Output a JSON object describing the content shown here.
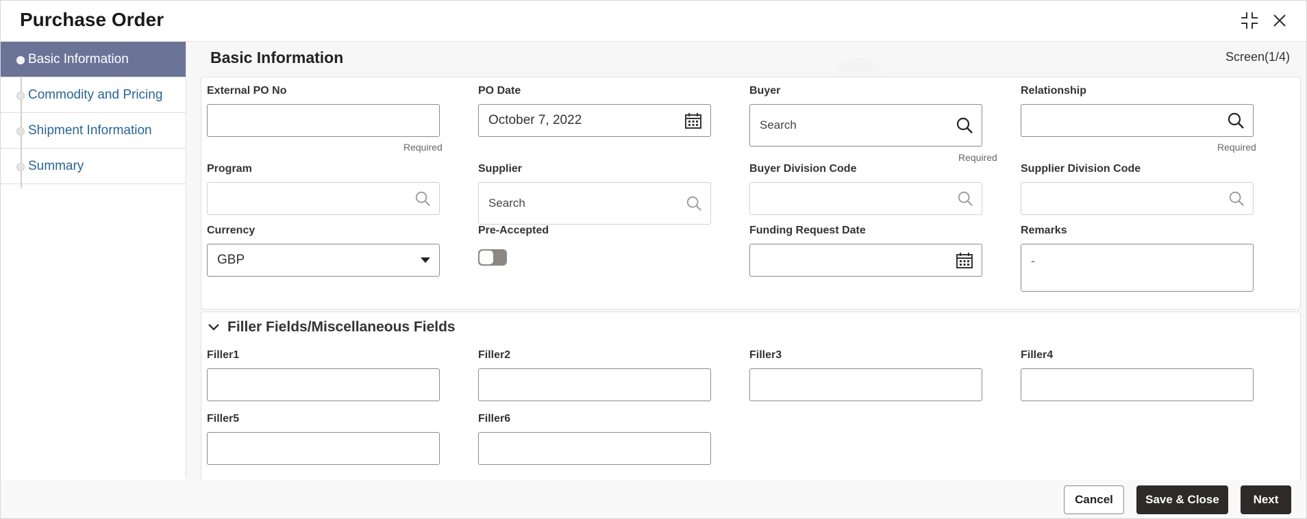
{
  "window": {
    "title": "Purchase Order"
  },
  "sidebar": {
    "items": [
      {
        "label": "Basic Information",
        "active": true
      },
      {
        "label": "Commodity and Pricing",
        "active": false
      },
      {
        "label": "Shipment Information",
        "active": false
      },
      {
        "label": "Summary",
        "active": false
      }
    ]
  },
  "main": {
    "heading": "Basic Information",
    "screen_indicator": "Screen(1/4)",
    "fields": {
      "external_po_no": {
        "label": "External PO No",
        "value": "",
        "hint": "Required"
      },
      "po_date": {
        "label": "PO Date",
        "value": "October 7, 2022"
      },
      "buyer": {
        "label": "Buyer",
        "placeholder": "Search",
        "hint": "Required"
      },
      "relationship": {
        "label": "Relationship",
        "value": "",
        "hint": "Required"
      },
      "program": {
        "label": "Program",
        "value": ""
      },
      "supplier": {
        "label": "Supplier",
        "placeholder": "Search"
      },
      "buyer_division_code": {
        "label": "Buyer Division Code",
        "value": ""
      },
      "supplier_division_code": {
        "label": "Supplier Division Code",
        "value": ""
      },
      "currency": {
        "label": "Currency",
        "value": "GBP"
      },
      "pre_accepted": {
        "label": "Pre-Accepted",
        "on": false
      },
      "funding_request_date": {
        "label": "Funding Request Date",
        "value": ""
      },
      "remarks": {
        "label": "Remarks",
        "value": "-"
      }
    },
    "filler_section": {
      "title": "Filler Fields/Miscellaneous Fields",
      "expanded": true,
      "fields": [
        {
          "label": "Filler1",
          "value": ""
        },
        {
          "label": "Filler2",
          "value": ""
        },
        {
          "label": "Filler3",
          "value": ""
        },
        {
          "label": "Filler4",
          "value": ""
        },
        {
          "label": "Filler5",
          "value": ""
        },
        {
          "label": "Filler6",
          "value": ""
        }
      ]
    }
  },
  "footer": {
    "cancel_label": "Cancel",
    "save_close_label": "Save & Close",
    "next_label": "Next"
  },
  "colors": {
    "sidebar_active_bg": "#6b7497",
    "link_text": "#2a6496",
    "primary_button": "#2d2a28",
    "toggle_off": "#8c8783"
  },
  "icons": {
    "minimize": "compress-icon",
    "close": "close-icon",
    "calendar": "calendar-icon",
    "search": "search-icon",
    "dropdown": "caret-down-icon",
    "collapse": "chevron-down-icon"
  }
}
